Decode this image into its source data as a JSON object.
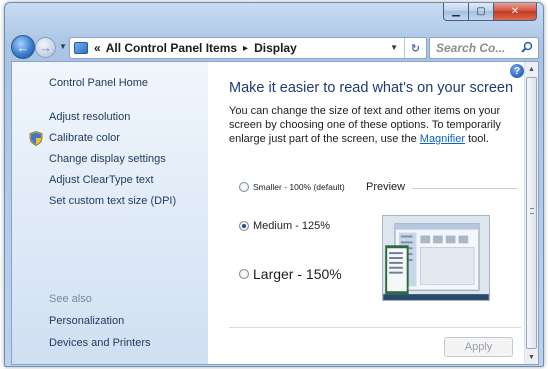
{
  "window": {
    "title": "Display"
  },
  "caption": {
    "minimize_icon": "minimize-icon",
    "maximize_icon": "maximize-icon",
    "close_icon": "close-icon"
  },
  "nav": {
    "breadcrumb_prefix": "«",
    "breadcrumb": [
      "All Control Panel Items",
      "Display"
    ],
    "separator": "▸",
    "search_placeholder": "Search Co..."
  },
  "sidebar": {
    "home": "Control Panel Home",
    "links": [
      "Adjust resolution",
      "Calibrate color",
      "Change display settings",
      "Adjust ClearType text",
      "Set custom text size (DPI)"
    ],
    "see_also": "See also",
    "see_also_links": [
      "Personalization",
      "Devices and Printers"
    ]
  },
  "main": {
    "heading": "Make it easier to read what's on your screen",
    "desc_before": "You can change the size of text and other items on your screen by choosing one of these options. To temporarily enlarge just part of the screen, use the ",
    "desc_link": "Magnifier",
    "desc_after": " tool.",
    "options": [
      {
        "label": "Smaller - 100% (default)",
        "checked": false
      },
      {
        "label": "Medium - 125%",
        "checked": true
      },
      {
        "label": "Larger - 150%",
        "checked": false
      }
    ],
    "preview_label": "Preview",
    "apply": "Apply"
  },
  "colors": {
    "heading": "#1d3d74",
    "link": "#0b62c5",
    "sidebar_link": "#1e395b"
  }
}
